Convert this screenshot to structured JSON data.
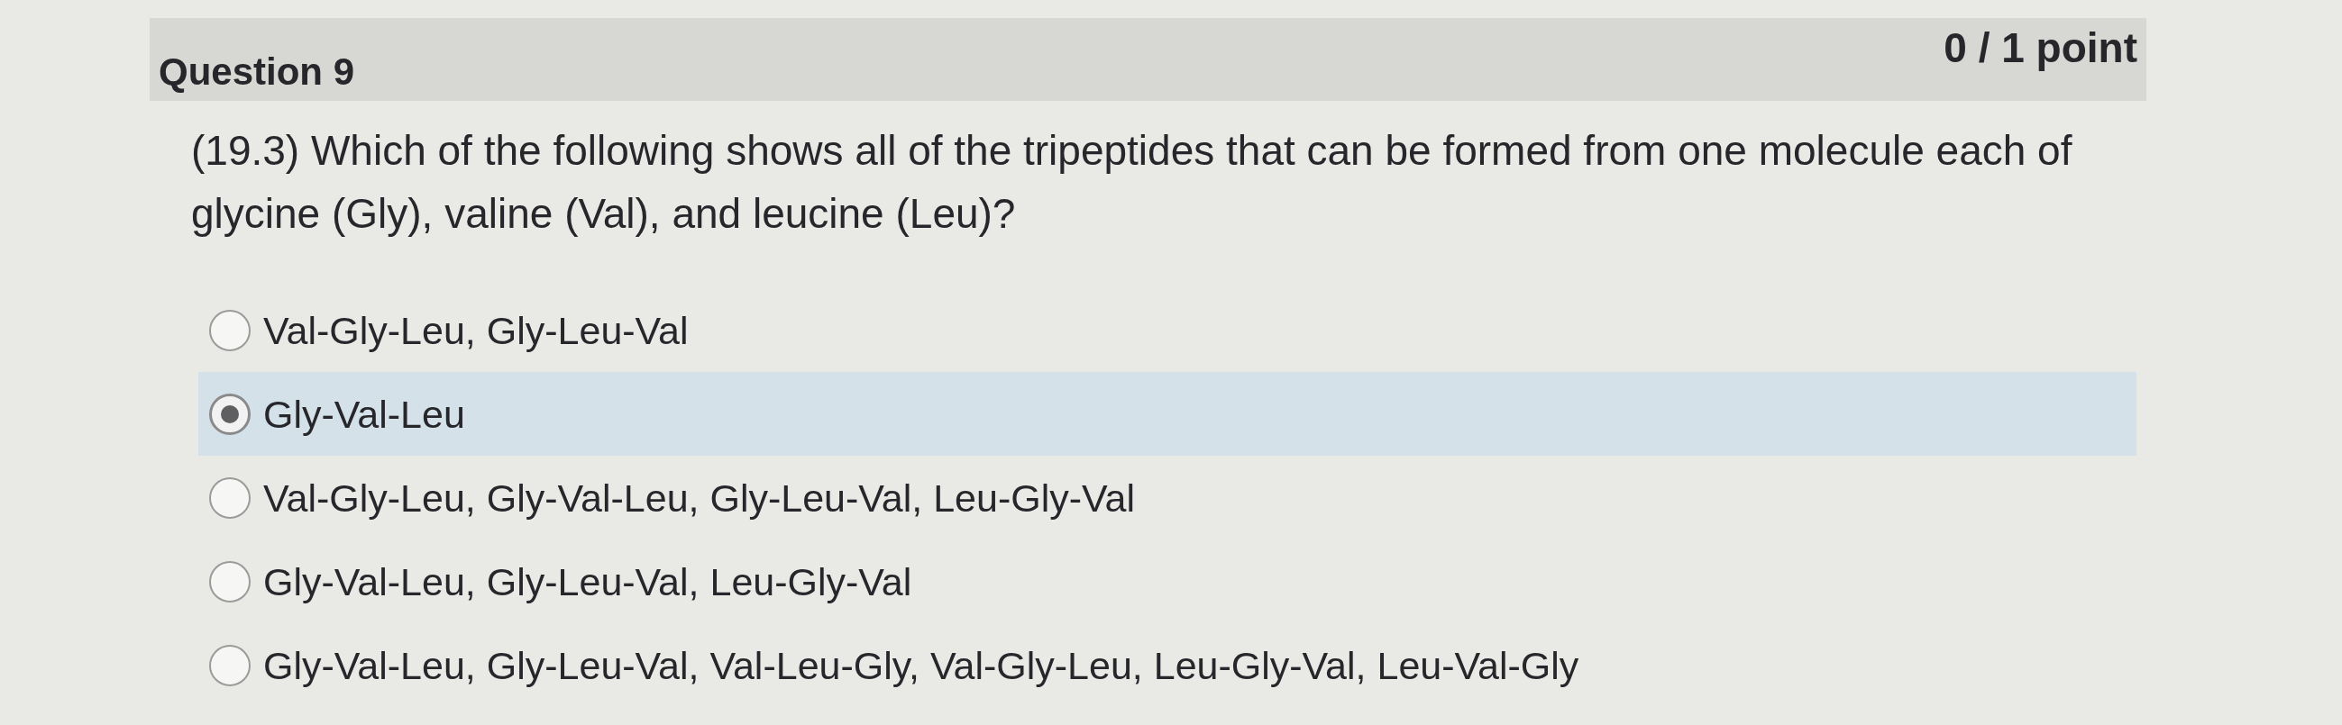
{
  "question": {
    "title": "Question 9",
    "score": "0 / 1 point",
    "text": "(19.3) Which of the following shows all of the tripeptides that can be formed from one molecule each of glycine (Gly), valine (Val), and leucine (Leu)?"
  },
  "options": [
    {
      "label": "Val-Gly-Leu, Gly-Leu-Val",
      "selected": false
    },
    {
      "label": "Gly-Val-Leu",
      "selected": true
    },
    {
      "label": "Val-Gly-Leu, Gly-Val-Leu, Gly-Leu-Val, Leu-Gly-Val",
      "selected": false
    },
    {
      "label": "Gly-Val-Leu, Gly-Leu-Val, Leu-Gly-Val",
      "selected": false
    },
    {
      "label": "Gly-Val-Leu, Gly-Leu-Val, Val-Leu-Gly, Val-Gly-Leu, Leu-Gly-Val, Leu-Val-Gly",
      "selected": false
    }
  ]
}
